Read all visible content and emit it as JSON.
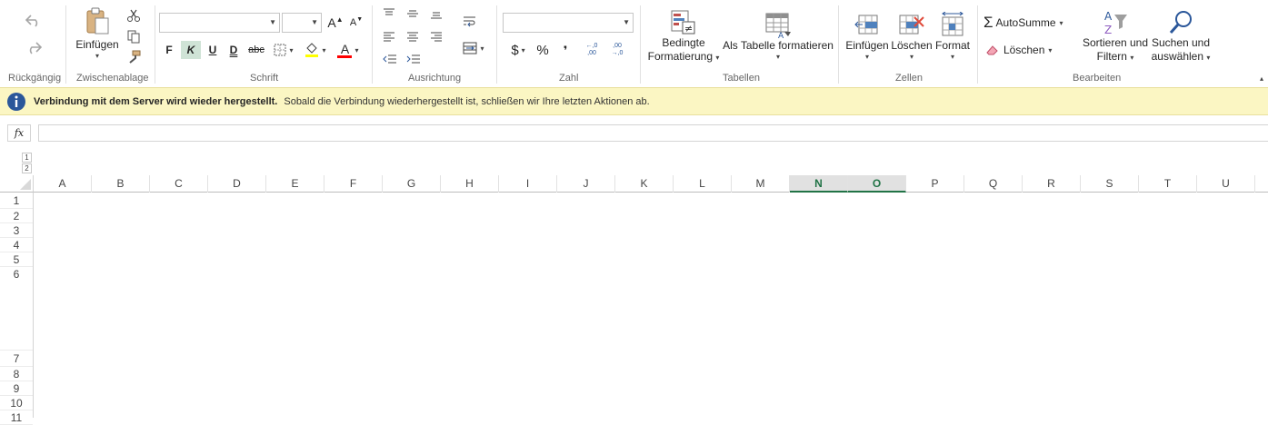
{
  "ribbon": {
    "undo": {
      "group_label": "Rückgängig",
      "undo_icon": "undo-icon",
      "redo_icon": "redo-icon"
    },
    "clipboard": {
      "group_label": "Zwischenablage",
      "paste_label": "Einfügen"
    },
    "font": {
      "group_label": "Schrift",
      "font_name": "",
      "font_size": "",
      "bold_label": "F",
      "italic_label": "K",
      "underline_label": "U",
      "double_underline_label": "D",
      "strike_label": "abc",
      "grow_label": "A",
      "shrink_label": "A",
      "font_color_label": "A",
      "highlight_color": "#ffff00",
      "font_color": "#ff0000"
    },
    "alignment": {
      "group_label": "Ausrichtung"
    },
    "number": {
      "group_label": "Zahl",
      "format_value": "",
      "currency_label": "$",
      "percent_label": "%",
      "comma_label": "❜",
      "inc_decimal": "←,0 ,00",
      "dec_decimal": ",00 →,0"
    },
    "tables": {
      "group_label": "Tabellen",
      "conditional_line1": "Bedingte",
      "conditional_line2": "Formatierung",
      "format_table_label": "Als Tabelle formatieren"
    },
    "cells": {
      "group_label": "Zellen",
      "insert_label": "Einfügen",
      "delete_label": "Löschen",
      "format_label": "Format"
    },
    "editing": {
      "group_label": "Bearbeiten",
      "autosum_label": "AutoSumme",
      "clear_label": "Löschen",
      "sort_line1": "Sortieren und",
      "sort_line2": "Filtern",
      "find_line1": "Suchen und",
      "find_line2": "auswählen"
    }
  },
  "infobar": {
    "bold_text": "Verbindung mit dem Server wird wieder hergestellt.",
    "message": "Sobald die Verbindung wiederhergestellt ist, schließen wir Ihre letzten Aktionen ab."
  },
  "formula_bar": {
    "fx_label": "fx",
    "value": ""
  },
  "sheet": {
    "outline_levels": [
      "1",
      "2"
    ],
    "columns": [
      "A",
      "B",
      "C",
      "D",
      "E",
      "F",
      "G",
      "H",
      "I",
      "J",
      "K",
      "L",
      "M",
      "N",
      "O",
      "P",
      "Q",
      "R",
      "S",
      "T",
      "U"
    ],
    "selected_columns": [
      "N",
      "O"
    ],
    "rows": [
      "1",
      "2",
      "3",
      "4",
      "5",
      "6",
      "7",
      "8",
      "9",
      "10",
      "11"
    ],
    "accent_color": "#217346"
  }
}
